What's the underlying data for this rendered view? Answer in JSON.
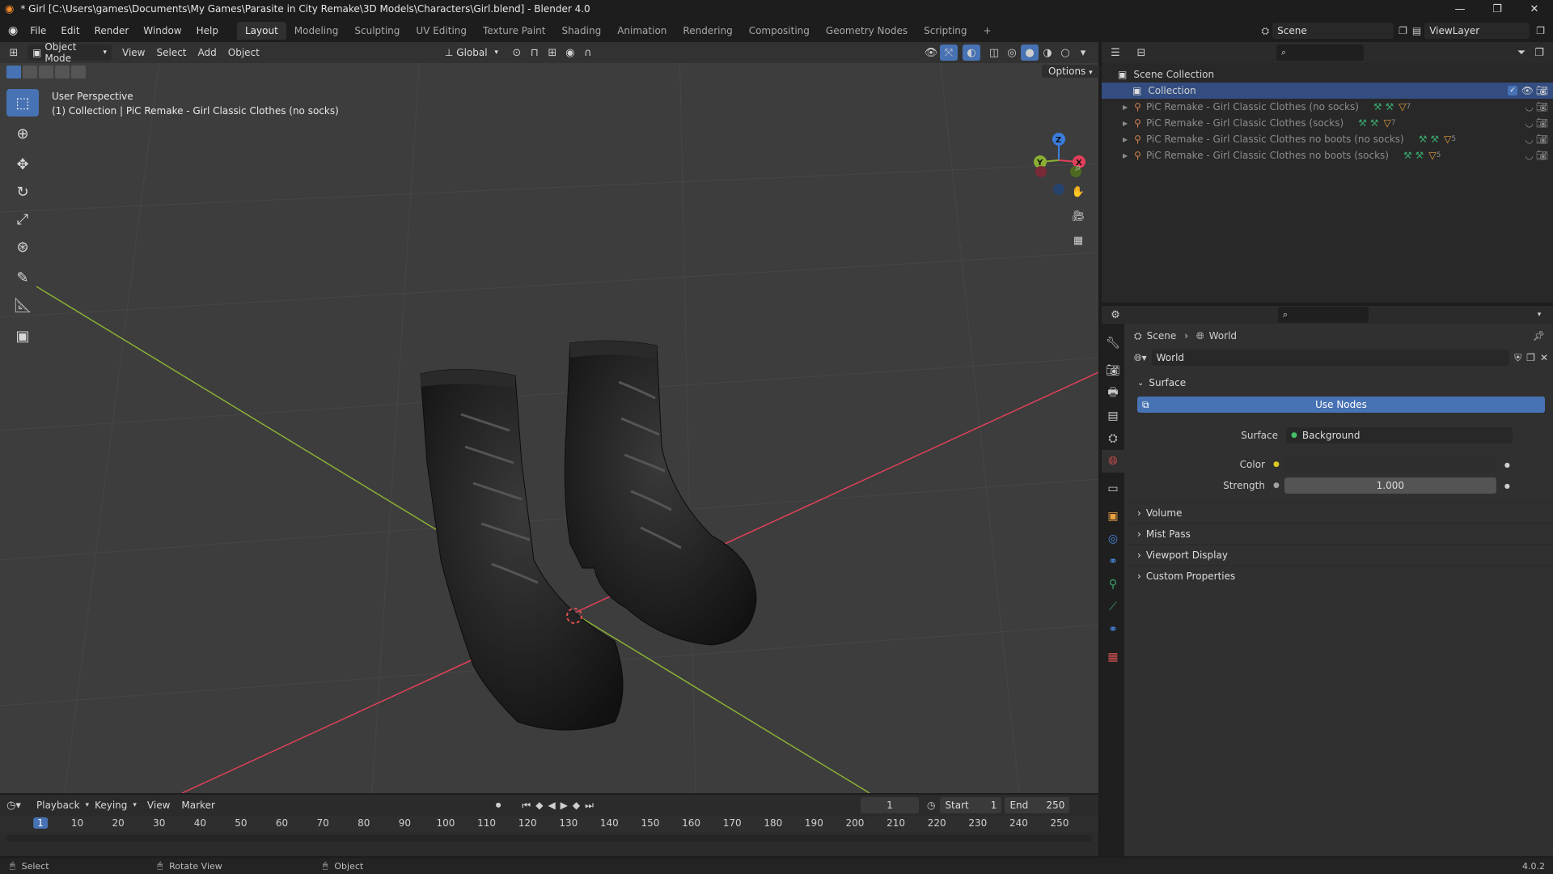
{
  "window": {
    "title": "* Girl [C:\\Users\\games\\Documents\\My Games\\Parasite in City Remake\\3D Models\\Characters\\Girl.blend] - Blender 4.0",
    "minimize": "—",
    "maximize": "❐",
    "close": "✕"
  },
  "menubar": {
    "menus": [
      "File",
      "Edit",
      "Render",
      "Window",
      "Help"
    ],
    "workspaces": [
      "Layout",
      "Modeling",
      "Sculpting",
      "UV Editing",
      "Texture Paint",
      "Shading",
      "Animation",
      "Rendering",
      "Compositing",
      "Geometry Nodes",
      "Scripting"
    ],
    "active_workspace": "Layout",
    "add_workspace": "+",
    "scene_label": "Scene",
    "viewlayer_label": "ViewLayer"
  },
  "viewport_header": {
    "mode": "Object Mode",
    "menus": [
      "View",
      "Select",
      "Add",
      "Object"
    ],
    "transform_orientation": "Global",
    "options": "Options"
  },
  "viewport": {
    "perspective": "User Perspective",
    "context": "(1) Collection | PiC Remake - Girl Classic Clothes (no socks)",
    "gizmo_axes": [
      "X",
      "Y",
      "Z"
    ]
  },
  "toolbar": {
    "tools": [
      "select-box",
      "cursor",
      "move",
      "rotate",
      "scale",
      "transform",
      "annotate",
      "measure",
      "add-cube"
    ],
    "active_tool": "select-box"
  },
  "outliner": {
    "root": "Scene Collection",
    "collection": "Collection",
    "items": [
      {
        "name": "PiC Remake - Girl Classic Clothes (no socks)",
        "count": "7"
      },
      {
        "name": "PiC Remake - Girl Classic Clothes (socks)",
        "count": "7"
      },
      {
        "name": "PiC Remake - Girl Classic Clothes no boots (no socks)",
        "count": "5"
      },
      {
        "name": "PiC Remake - Girl Classic Clothes no boots (socks)",
        "count": "5"
      }
    ]
  },
  "properties": {
    "breadcrumb": [
      "Scene",
      "World"
    ],
    "world_name": "World",
    "surface_section": "Surface",
    "use_nodes": "Use Nodes",
    "surface_label": "Surface",
    "surface_value": "Background",
    "color_label": "Color",
    "strength_label": "Strength",
    "strength_value": "1.000",
    "collapsed_sections": [
      "Volume",
      "Mist Pass",
      "Viewport Display",
      "Custom Properties"
    ]
  },
  "timeline": {
    "menus": [
      "Playback",
      "Keying",
      "View",
      "Marker"
    ],
    "current_frame": "1",
    "start_label": "Start",
    "start_value": "1",
    "end_label": "End",
    "end_value": "250",
    "ruler": [
      "1",
      "10",
      "20",
      "30",
      "40",
      "50",
      "60",
      "70",
      "80",
      "90",
      "100",
      "110",
      "120",
      "130",
      "140",
      "150",
      "160",
      "170",
      "180",
      "190",
      "200",
      "210",
      "220",
      "230",
      "240",
      "250"
    ]
  },
  "statusbar": {
    "select": "Select",
    "rotate_view": "Rotate View",
    "object": "Object",
    "version": "4.0.2"
  },
  "colors": {
    "accent": "#4772b3",
    "x_axis": "#e0405a",
    "y_axis": "#8ab033",
    "z_axis": "#3b7ddd"
  }
}
